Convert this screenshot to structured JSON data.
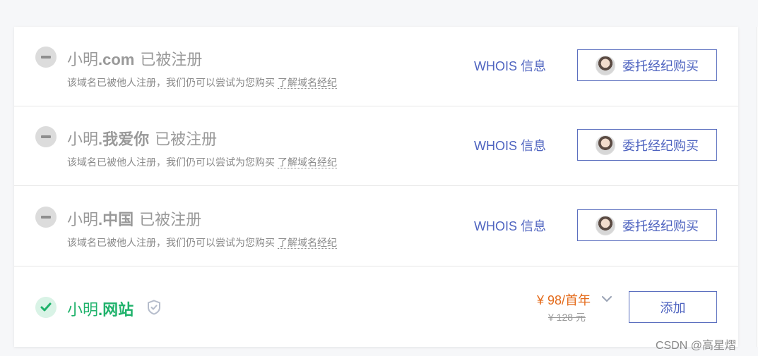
{
  "rows": [
    {
      "status": "registered",
      "domain_name": "小明",
      "domain_suffix": ".com",
      "status_text": "已被注册",
      "note": "该域名已被他人注册，我们仍可以尝试为您购买",
      "learn_link": "了解域名经纪",
      "whois_label": "WHOIS 信息",
      "action_label": "委托经纪购买"
    },
    {
      "status": "registered",
      "domain_name": "小明",
      "domain_suffix": ".我爱你",
      "status_text": "已被注册",
      "note": "该域名已被他人注册，我们仍可以尝试为您购买",
      "learn_link": "了解域名经纪",
      "whois_label": "WHOIS 信息",
      "action_label": "委托经纪购买"
    },
    {
      "status": "registered",
      "domain_name": "小明",
      "domain_suffix": ".中国",
      "status_text": "已被注册",
      "note": "该域名已被他人注册，我们仍可以尝试为您购买",
      "learn_link": "了解域名经纪",
      "whois_label": "WHOIS 信息",
      "action_label": "委托经纪购买"
    },
    {
      "status": "available",
      "domain_name": "小明",
      "domain_suffix": ".网站",
      "price": "¥ 98/首年",
      "old_price": "¥ 128 元",
      "action_label": "添加"
    }
  ],
  "icons": {
    "registered": "minus-circle-icon",
    "available": "check-circle-icon",
    "badge": "shield-icon",
    "dropdown": "chevron-down-icon"
  },
  "colors": {
    "accent": "#4f64c0",
    "available": "#1fb26b",
    "price": "#e46b1b",
    "muted": "#999999"
  },
  "watermark": "CSDN @高星熠"
}
